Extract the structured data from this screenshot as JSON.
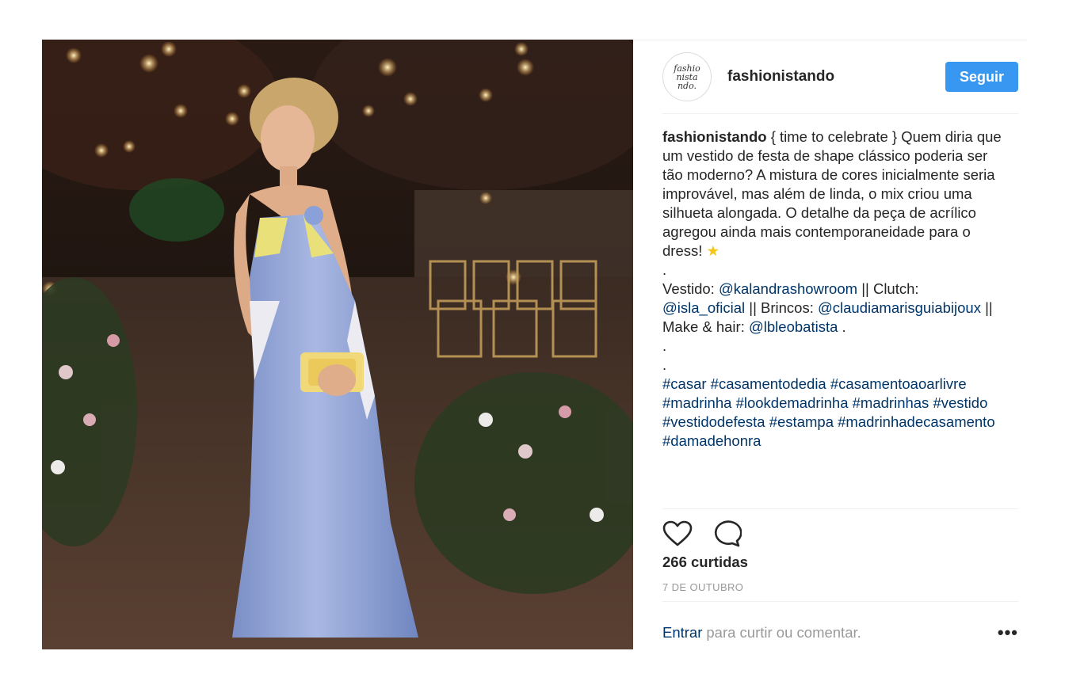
{
  "post": {
    "username": "fashionistando",
    "avatar_text": "fashio\nnista\nndo.",
    "follow_label": "Seguir",
    "caption": {
      "user": "fashionistando",
      "line1": " { time to celebrate } Quem diria que um vestido de festa de shape clássico poderia ser tão moderno? A mistura de cores inicialmente seria improvável, mas além de linda, o mix criou uma silhueta alongada. O detalhe da peça de acrílico agregou ainda mais contemporaneidade para o dress! ",
      "star": "★",
      "dot1": ".",
      "credits": {
        "label_vestido": "Vestido: ",
        "mention_vestido": "@kalandrashowroom",
        "label_clutch": " || Clutch: ",
        "mention_clutch": "@isla_oficial",
        "label_brincos": " || Brincos: ",
        "mention_brincos": "@claudiamarisguiabijoux",
        "label_make": " || Make & hair: ",
        "mention_make": "@lbleobatista",
        "tail": " ."
      },
      "dot2": ".",
      "dot3": ".",
      "hashtags": [
        "#casar",
        "#casamentodedia",
        "#casamentoaoarlivre",
        "#madrinha",
        "#lookdemadrinha",
        "#madrinhas",
        "#vestido",
        "#vestidodefesta",
        "#estampa",
        "#madrinhadecasamento",
        "#damadehonra"
      ]
    },
    "icons": {
      "like": "heart-icon",
      "comment": "comment-icon",
      "more": "ellipsis-icon"
    },
    "likes_text": "266 curtidas",
    "date_text": "7 DE OUTUBRO",
    "login_link": "Entrar",
    "login_rest": "para curtir ou comentar.",
    "more_label": "•••",
    "colors": {
      "accent": "#3897f0",
      "link": "#003569",
      "muted": "#999999",
      "text": "#262626"
    }
  }
}
